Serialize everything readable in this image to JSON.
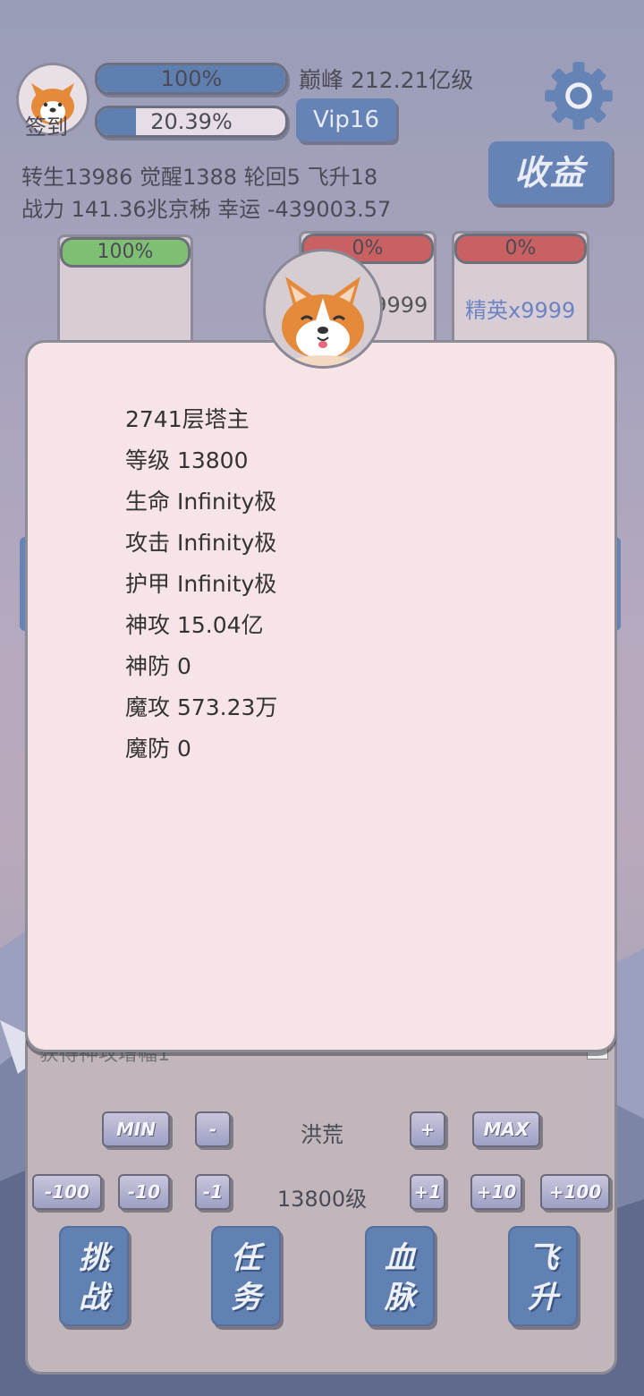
{
  "header": {
    "sign_in_label": "签到",
    "bar1_text": "100%",
    "bar1_percent": 100,
    "peak_text": "巅峰 212.21亿级",
    "bar2_text": "20.39%",
    "bar2_percent": 20.39,
    "vip_label": "Vip16",
    "income_label": "收益",
    "stats_line1": "转生13986 觉醒1388 轮回5 飞升18",
    "stats_line2": "战力 141.36兆京秭  幸运 -439003.57"
  },
  "cards": {
    "left_percent": "100%",
    "mid_percent": "0%",
    "mid_count": "x9999",
    "right_percent": "0%",
    "right_label": "精英x9999"
  },
  "modal": {
    "stats": [
      "2741层塔主",
      "等级 13800",
      "生命 Infinity极",
      "攻击 Infinity极",
      "护甲 Infinity极",
      "神攻 15.04亿",
      "神防 0",
      "魔攻 573.23万",
      "魔防 0"
    ],
    "hidden_text": "获得神攻增幅1"
  },
  "controls": {
    "min_label": "MIN",
    "minus_label": "-",
    "realm_label": "洪荒",
    "plus_label": "+",
    "max_label": "MAX",
    "m100": "-100",
    "m10": "-10",
    "m1": "-1",
    "level_label": "13800级",
    "p1": "+1",
    "p10": "+10",
    "p100": "+100"
  },
  "actions": [
    {
      "l1": "挑",
      "l2": "战"
    },
    {
      "l1": "任",
      "l2": "务"
    },
    {
      "l1": "血",
      "l2": "脉"
    },
    {
      "l1": "飞",
      "l2": "升"
    }
  ],
  "colors": {
    "accent_blue": "#6583b5",
    "green_bar": "#7fbf74",
    "red_bar": "#c96163",
    "modal_bg": "#f7e4e7"
  }
}
